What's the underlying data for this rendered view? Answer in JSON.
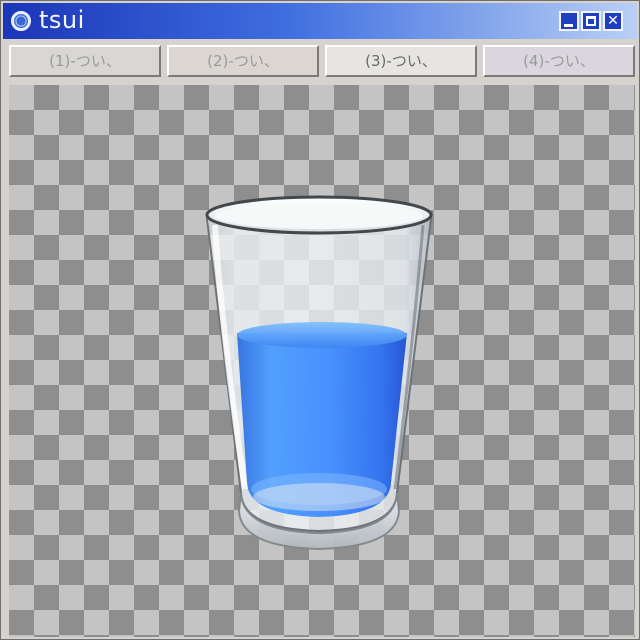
{
  "window": {
    "title": "tsui",
    "controls": {
      "minimize": "minimize",
      "maximize": "maximize",
      "close": "close"
    }
  },
  "tabs": [
    {
      "label": "(1)-つい、",
      "active": false
    },
    {
      "label": "(2)-つい、",
      "active": false
    },
    {
      "label": "(3)-つい、",
      "active": true
    },
    {
      "label": "(4)-つい、",
      "active": false
    }
  ],
  "canvas": {
    "background": "transparency-checkerboard",
    "content": "glass-of-water",
    "liquid_color": "#3a8cff",
    "liquid_fill_level": 0.6
  }
}
